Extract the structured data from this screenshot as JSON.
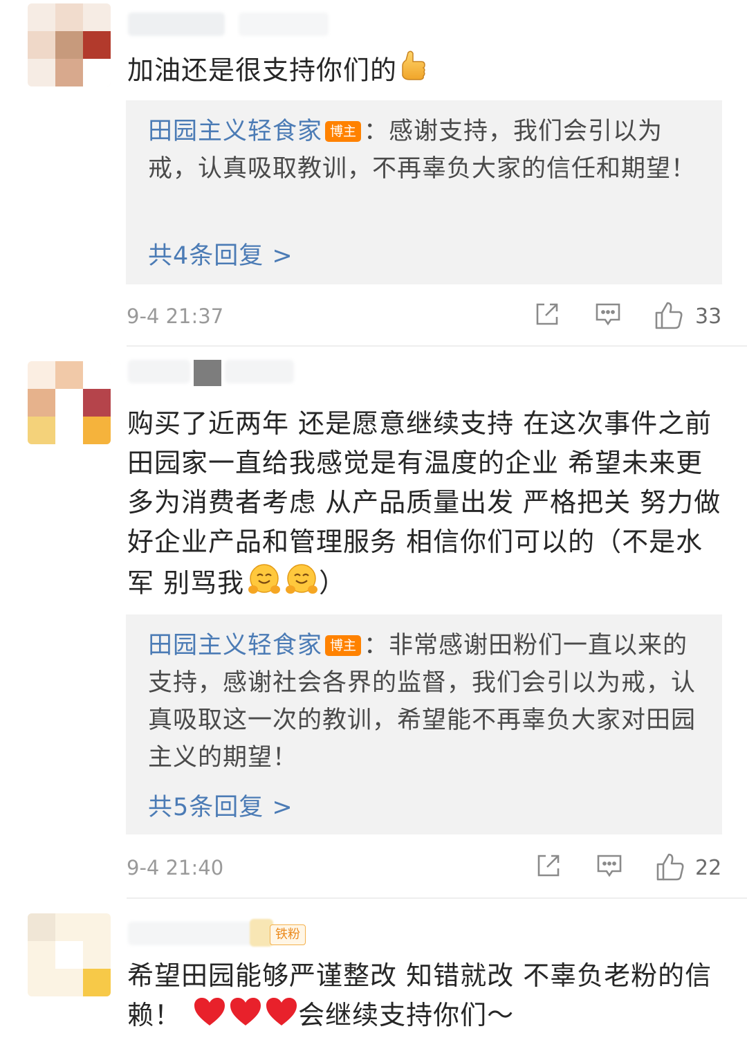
{
  "comments": [
    {
      "text": "加油还是很支持你们的",
      "emoji": "thumbs-up",
      "reply": {
        "author": "田园主义轻食家",
        "badge": "博主",
        "text": "：感谢支持，我们会引以为戒，认真吸取教训，不再辜负大家的信任和期望！",
        "more": "共4条回复 >"
      },
      "time": "9-4 21:37",
      "likes": "33"
    },
    {
      "text": "购买了近两年 还是愿意继续支持 在这次事件之前田园家一直给我感觉是有温度的企业 希望未来更多为消费者考虑 从产品质量出发 严格把关 努力做好企业产品和管理服务 相信你们可以的（不是水军 别骂我",
      "text_end": "）",
      "emoji": "hugging-face",
      "reply": {
        "author": "田园主义轻食家",
        "badge": "博主",
        "text": "：非常感谢田粉们一直以来的支持，感谢社会各界的监督，我们会引以为戒，认真吸取这一次的教训，希望能不再辜负大家对田园主义的期望！",
        "more": "共5条回复 >"
      },
      "time": "9-4 21:40",
      "likes": "22"
    },
    {
      "badge": "铁粉",
      "text": "希望田园能够严谨整改  知错就改  不辜负老粉的信赖！",
      "emoji": "red-heart",
      "text_end": "会继续支持你们～"
    }
  ],
  "colors": {
    "link_blue": "#4b7bb5",
    "blogger_badge": "#ff8200",
    "reply_background": "#f2f2f2",
    "time_gray": "#9a9a9a"
  },
  "icons": [
    "share-icon",
    "comment-icon",
    "like-icon"
  ]
}
